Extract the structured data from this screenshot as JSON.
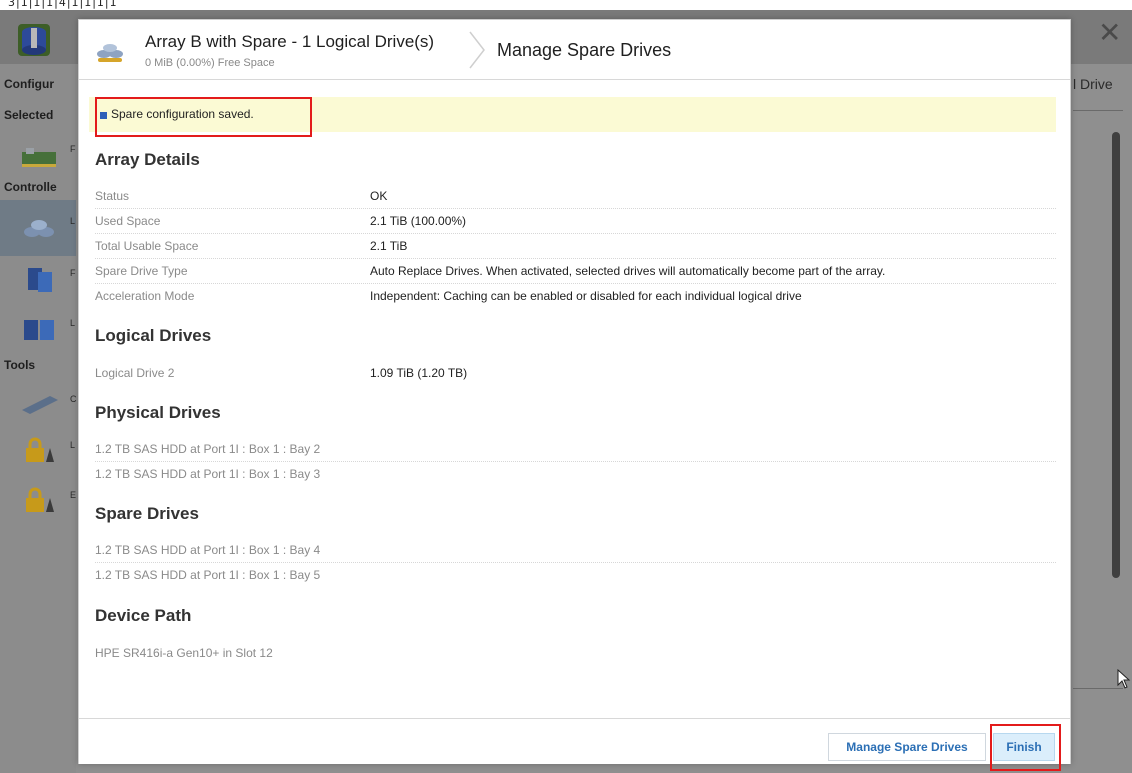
{
  "top_strip_text": "3|1|1|1|4|1|1|1|1",
  "background": {
    "sidebar": {
      "configure_title": "Configur",
      "selected_title": "Selected",
      "controllers_title": "Controlle",
      "tools_title": "Tools",
      "partial_letters": [
        "F",
        "L",
        "F",
        "L",
        "C",
        "L",
        "E"
      ]
    },
    "right_panel_title": "l Drive"
  },
  "modal": {
    "header": {
      "title": "Array B with Spare - 1 Logical Drive(s)",
      "subtitle": "0 MiB (0.00%) Free Space",
      "action_title": "Manage Spare Drives"
    },
    "alert": {
      "text": "Spare configuration saved.",
      "accent_color": "#2f5fb8"
    },
    "array_details": {
      "heading": "Array Details",
      "rows": [
        {
          "label": "Status",
          "value": "OK"
        },
        {
          "label": "Used Space",
          "value": "2.1 TiB (100.00%)"
        },
        {
          "label": "Total Usable Space",
          "value": "2.1 TiB"
        },
        {
          "label": "Spare Drive Type",
          "value": "Auto Replace Drives. When activated, selected drives will automatically become part of the array."
        },
        {
          "label": "Acceleration Mode",
          "value": "Independent: Caching can be enabled or disabled for each individual logical drive"
        }
      ]
    },
    "logical_drives": {
      "heading": "Logical Drives",
      "rows": [
        {
          "label": "Logical Drive 2",
          "value": "1.09 TiB (1.20 TB)"
        }
      ]
    },
    "physical_drives": {
      "heading": "Physical Drives",
      "items": [
        "1.2 TB SAS HDD at Port 1I : Box 1 : Bay 2",
        "1.2 TB SAS HDD at Port 1I : Box 1 : Bay 3"
      ]
    },
    "spare_drives": {
      "heading": "Spare Drives",
      "items": [
        "1.2 TB SAS HDD at Port 1I : Box 1 : Bay 4",
        "1.2 TB SAS HDD at Port 1I : Box 1 : Bay 5"
      ]
    },
    "device_path": {
      "heading": "Device Path",
      "value": "HPE SR416i-a Gen10+ in Slot 12"
    },
    "footer": {
      "manage_spare_label": "Manage Spare Drives",
      "finish_label": "Finish"
    }
  },
  "colors": {
    "accent_blue": "#2b6fb5",
    "highlight_red": "#e31b1b",
    "alert_background": "#fbfad4"
  }
}
